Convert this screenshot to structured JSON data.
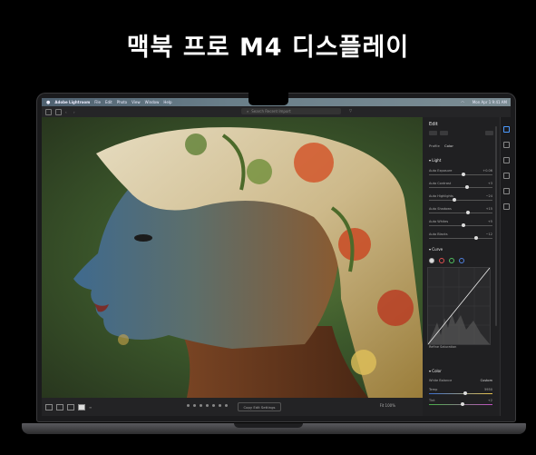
{
  "headline": "맥북 프로 M4 디스플레이",
  "menubar": {
    "items": [
      "Adobe Lightroom",
      "File",
      "Edit",
      "Photo",
      "View",
      "Window",
      "Help"
    ],
    "clock": "Mon Apr 1  9:41 AM"
  },
  "toolbar": {
    "search_placeholder": "Search Recent Import"
  },
  "panel": {
    "title": "Edit",
    "profile_label": "Profile",
    "profile_value": "Color",
    "light_section": "Light",
    "sliders": [
      {
        "label": "Auto Exposure",
        "value": "+0.06",
        "level": 0.55
      },
      {
        "label": "Auto Contrast",
        "value": "+3",
        "level": 0.6
      },
      {
        "label": "Auto Highlights",
        "value": "−24",
        "level": 0.4
      },
      {
        "label": "Auto Shadows",
        "value": "+15",
        "level": 0.62
      },
      {
        "label": "Auto Whites",
        "value": "+5",
        "level": 0.55
      },
      {
        "label": "Auto Blacks",
        "value": "−12",
        "level": 0.75
      }
    ],
    "curve_section": "Curve",
    "curve_footer": "Refine Saturation",
    "color_section": "Color",
    "color_rows": [
      {
        "label": "White Balance",
        "value": "Custom"
      },
      {
        "label": "Temp",
        "value": "5950"
      },
      {
        "label": "Tint",
        "value": "+2"
      }
    ]
  },
  "bottombar": {
    "copy_edit_label": "Copy Edit Settings",
    "fit_label": "Fit  100%"
  },
  "colors": {
    "accent": "#4c9aff",
    "menubar": "#5c7080",
    "panel": "#202022"
  }
}
